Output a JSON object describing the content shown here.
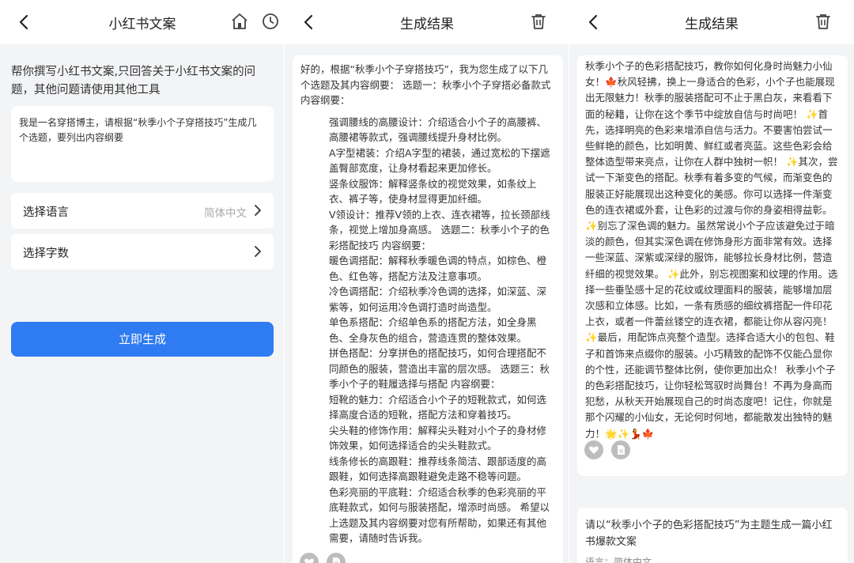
{
  "panel1": {
    "title": "小红书文案",
    "intro": "帮你撰写小红书文案,只回答关于小红书文案的问题，其他问题请使用其他工具",
    "prompt": "我是一名穿搭博主，请根据“秋季小个子穿搭技巧”生成几个选题，要列出内容纲要",
    "language_label": "选择语言",
    "language_value": "简体中文",
    "wordcount_label": "选择字数",
    "generate_button": "立即生成"
  },
  "panel2": {
    "title": "生成结果",
    "lines": [
      "好的，根据“秋季小个子穿搭技巧”，我为您生成了以下几个选题及其内容纲要： 选题一：秋季小个子穿搭必备款式 内容纲要：",
      "强调腰线的高腰设计：介绍适合小个子的高腰裤、高腰裙等款式，强调腰线提升身材比例。",
      "A字型裙装：介绍A字型的裙装，通过宽松的下摆遮盖臀部宽度，让身材看起来更加修长。",
      "竖条纹服饰：解释竖条纹的视觉效果，如条纹上衣、裤子等，使身材显得更加纤细。",
      "V领设计：推荐V领的上衣、连衣裙等，拉长颈部线条，视觉上增加身高感。 选题二：秋季小个子的色彩搭配技巧 内容纲要：",
      "暖色调搭配：解释秋季暖色调的特点，如棕色、橙色、红色等，搭配方法及注意事项。",
      "冷色调搭配：介绍秋季冷色调的选择，如深蓝、深紫等，如何运用冷色调打造时尚造型。",
      "单色系搭配：介绍单色系的搭配方法，如全身黑色、全身灰色的组合，营造连贯的整体效果。",
      "拼色搭配：分享拼色的搭配技巧，如何合理搭配不同颜色的服装，营造出丰富的层次感。 选题三：秋季小个子的鞋履选择与搭配 内容纲要：",
      "短靴的魅力：介绍适合小个子的短靴款式，如何选择高度合适的短靴，搭配方法和穿着技巧。",
      "尖头鞋的修饰作用：解释尖头鞋对小个子的身材修饰效果，如何选择适合的尖头鞋款式。",
      "线条修长的高跟鞋：推荐线条简洁、跟部适度的高跟鞋，如何选择高跟鞋避免走路不稳等问题。",
      "色彩亮丽的平底鞋：介绍适合秋季的色彩亮丽的平底鞋款式，如何与服装搭配，增添时尚感。 希望以上选题及其内容纲要对您有所帮助，如果还有其他需要，请随时告诉我。"
    ]
  },
  "panel3": {
    "title": "生成结果",
    "article": "秋季小个子的色彩搭配技巧，教你如何化身时尚魅力小仙女！🍁秋风轻拂，换上一身适合的色彩，小个子也能展现出无限魅力！秋季的服装搭配可不止于黑白灰，来看看下面的秘籍，让你在这个季节中绽放自信与时尚吧！ ✨首先，选择明亮的色彩来增添自信与活力。不要害怕尝试一些鲜艳的颜色，比如明黄、鲜红或者亮蓝。这些色彩会给整体造型带来亮点，让你在人群中独树一帜！ ✨其次，尝试一下渐变色的搭配。秋季有着多变的气候，而渐变色的服装正好能展现出这种变化的美感。你可以选择一件渐变色的连衣裙或外套，让色彩的过渡与你的身姿相得益彰。 ✨别忘了深色调的魅力。虽然常说小个子应该避免过于暗淡的颜色，但其实深色调在修饰身形方面非常有效。选择一些深蓝、深紫或深绿的服饰，能够拉长身材比例，营造纤细的视觉效果。 ✨此外，别忘视图案和纹理的作用。选择一些垂坠感十足的花纹或纹理面料的服装，能够增加层次感和立体感。比如，一条有质感的细纹裤搭配一件印花上衣，或者一件蕾丝镂空的连衣裙，都能让你从容闪亮！ ✨最后，用配饰点亮整个造型。选择合适大小的包包、鞋子和首饰来点缀你的服装。小巧精致的配饰不仅能凸显你的个性，还能调节整体比例，使你更加出众！ 秋季小个子的色彩搭配技巧，让你轻松驾驭时尚舞台！不再为身高而犯愁，从秋天开始展现自己的时尚态度吧！记住，你就是那个闪耀的小仙女，无论何时何地，都能散发出独特的魅力！🌟✨💃🍁",
    "question": "请以“秋季小个子的色彩搭配技巧”为主题生成一篇小红书爆款文案",
    "meta": "语言：简体中文"
  }
}
